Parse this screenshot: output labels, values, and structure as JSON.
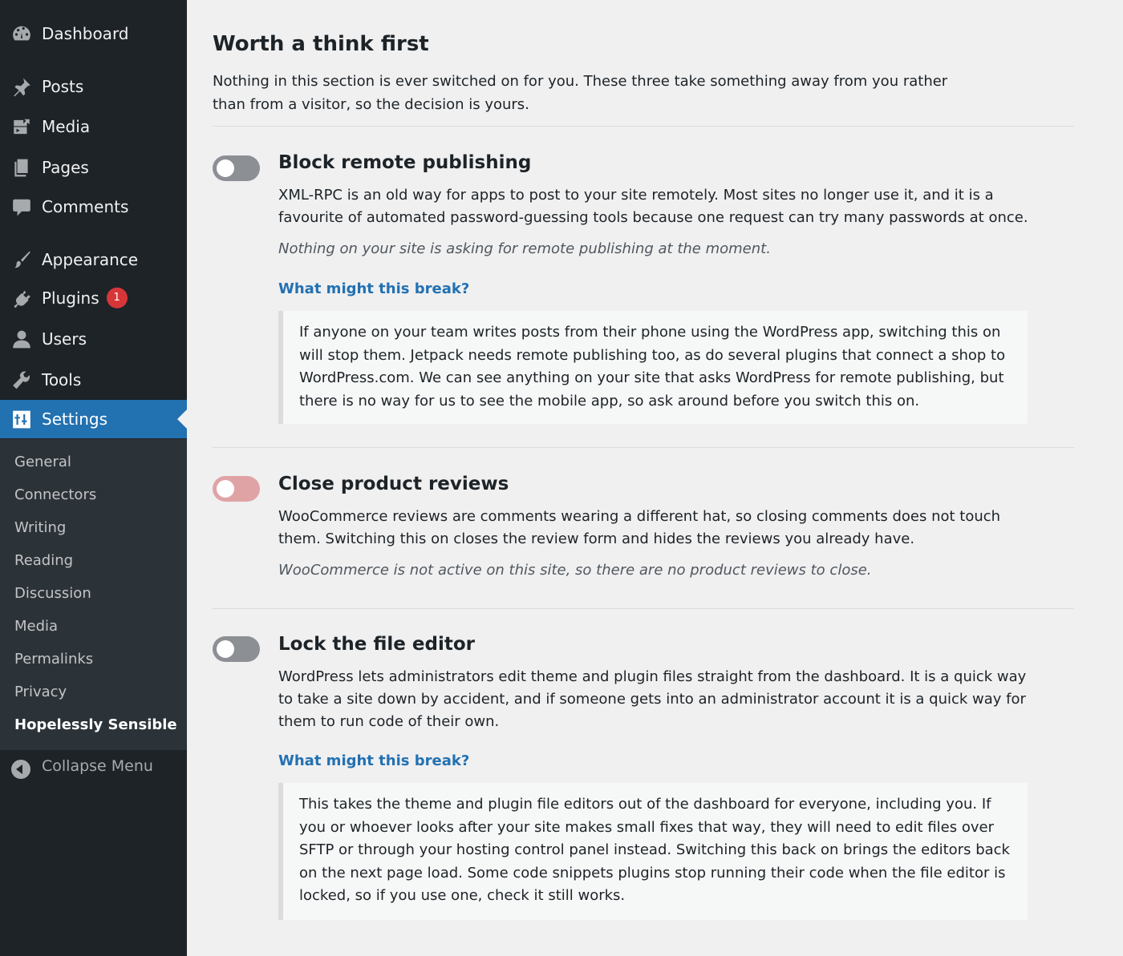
{
  "sidebar": {
    "items": [
      {
        "label": "Dashboard",
        "icon": "dashboard-icon"
      },
      {
        "label": "Posts",
        "icon": "pin-icon"
      },
      {
        "label": "Media",
        "icon": "media-icon"
      },
      {
        "label": "Pages",
        "icon": "pages-icon"
      },
      {
        "label": "Comments",
        "icon": "comment-icon"
      },
      {
        "label": "Appearance",
        "icon": "paintbrush-icon"
      },
      {
        "label": "Plugins",
        "icon": "plugin-icon",
        "badge": "1"
      },
      {
        "label": "Users",
        "icon": "user-icon"
      },
      {
        "label": "Tools",
        "icon": "wrench-icon"
      },
      {
        "label": "Settings",
        "icon": "settings-icon",
        "current": true
      }
    ],
    "submenu": [
      "General",
      "Connectors",
      "Writing",
      "Reading",
      "Discussion",
      "Media",
      "Permalinks",
      "Privacy",
      "Hopelessly Sensible"
    ],
    "collapse_label": "Collapse Menu"
  },
  "main": {
    "title": "Worth a think first",
    "description": "Nothing in this section is ever switched on for you. These three take something away from you rather than from a visitor, so the decision is yours.",
    "options": [
      {
        "title": "Block remote publishing",
        "toggle_state": "off",
        "description": "XML-RPC is an old way for apps to post to your site remotely. Most sites no longer use it, and it is a favourite of automated password-guessing tools because one request can try many passwords at once.",
        "status": "Nothing on your site is asking for remote publishing at the moment.",
        "link": "What might this break?",
        "note": "If anyone on your team writes posts from their phone using the WordPress app, switching this on will stop them. Jetpack needs remote publishing too, as do several plugins that connect a shop to WordPress.com. We can see anything on your site that asks WordPress for remote publishing, but there is no way for us to see the mobile app, so ask around before you switch this on."
      },
      {
        "title": "Close product reviews",
        "toggle_state": "disabled",
        "description": "WooCommerce reviews are comments wearing a different hat, so closing comments does not touch them. Switching this on closes the review form and hides the reviews you already have.",
        "status": "WooCommerce is not active on this site, so there are no product reviews to close."
      },
      {
        "title": "Lock the file editor",
        "toggle_state": "off",
        "description": "WordPress lets administrators edit theme and plugin files straight from the dashboard. It is a quick way to take a site down by accident, and if someone gets into an administrator account it is a quick way for them to run code of their own.",
        "link": "What might this break?",
        "note": "This takes the theme and plugin file editors out of the dashboard for everyone, including you. If you or whoever looks after your site makes small fixes that way, they will need to edit files over SFTP or through your hosting control panel instead. Switching this back on brings the editors back on the next page load. Some code snippets plugins stop running their code when the file editor is locked, so if you use one, check it still works."
      }
    ]
  },
  "colors": {
    "sidebar_bg": "#1d2327",
    "submenu_bg": "#2c3338",
    "accent": "#2271b1",
    "badge": "#d63638",
    "toggle_off": "#8c8f94",
    "toggle_disabled": "#e0a3a5"
  }
}
